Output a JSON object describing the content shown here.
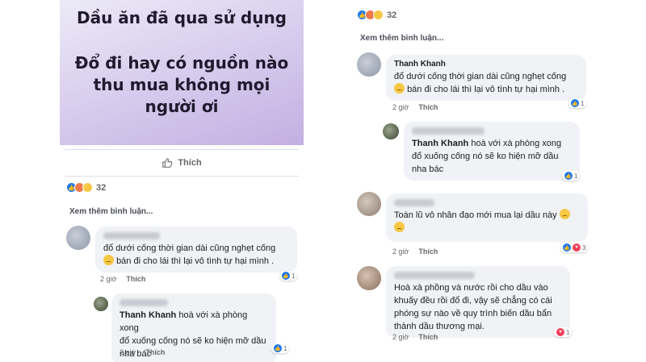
{
  "left": {
    "post_lines": [
      "Dầu ăn đã qua sử dụng",
      "Đổ đi hay có nguồn nào",
      "thu mua không mọi",
      "người ơi"
    ],
    "like_label": "Thích",
    "reaction_count": "32",
    "see_more": "Xem thêm bình luận...",
    "comments": [
      {
        "text_lines": [
          "đổ dưới cống thời gian dài cũng nghẹt cống",
          "bán đi cho lái thì lại vô tình tự hại mình ."
        ],
        "time": "2 giờ",
        "action": "Thích",
        "reaction_count": "1"
      },
      {
        "mention": "Thanh Khanh",
        "text_lines": [
          "hoà với xà phòng xong",
          "đổ xuống cống nó sẽ ko hiện mỡ dầu",
          "nha bác"
        ],
        "time": "2 giờ",
        "action": "Thích",
        "reaction_count": "1"
      }
    ]
  },
  "right": {
    "reaction_count": "32",
    "see_more": "Xem thêm bình luận...",
    "comments": [
      {
        "author": "Thanh Khanh",
        "text_lines": [
          "đổ dưới cống thời gian dài cũng nghẹt cống",
          "bán đi cho lái thì lại vô tình tự hại mình ."
        ],
        "time": "2 giờ",
        "action": "Thích",
        "reaction_count": "1"
      },
      {
        "mention": "Thanh Khanh",
        "text_lines": [
          "hoà với xà phòng xong",
          "đổ xuống cống nó sẽ ko hiện mỡ dầu",
          "nha bác"
        ],
        "time": "2 giờ",
        "action": "Thích",
        "reaction_count": "1"
      },
      {
        "text_lines": [
          "Toàn lũ vô nhân đạo mới mua lại dầu này"
        ],
        "time": "2 giờ",
        "action": "Thích",
        "reaction_count": "3"
      },
      {
        "text_lines": [
          "Hoà xà phồng và nước rồi cho dầu vào",
          "khuấy đều rồi đổ đi, vậy sẽ chẳng có cái",
          "phóng sự nào về quy trình biến dầu bẩn",
          "thành dầu thương mại."
        ],
        "time": "2 giờ",
        "action": "Thích",
        "reaction_count": "1"
      }
    ]
  }
}
